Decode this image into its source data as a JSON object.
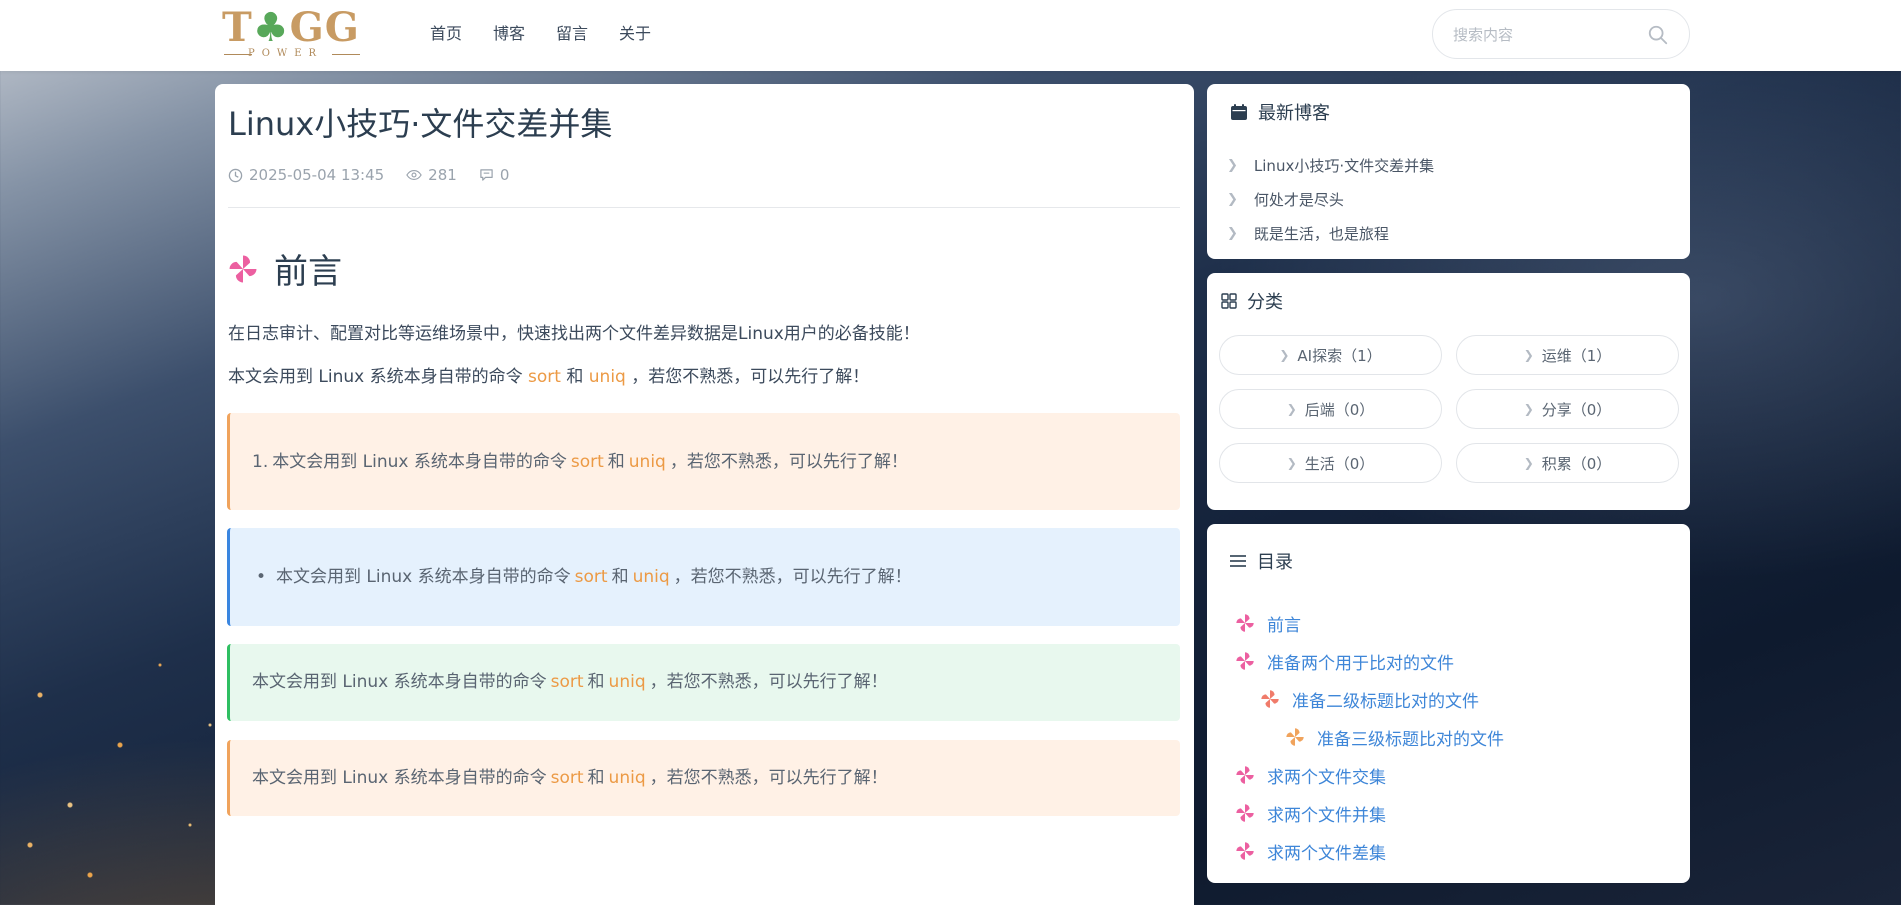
{
  "header": {
    "logo": {
      "main": "TOGG",
      "sub": "POWER"
    },
    "nav": [
      "首页",
      "博客",
      "留言",
      "关于"
    ],
    "search": {
      "placeholder": "搜索内容"
    }
  },
  "post": {
    "title": "Linux小技巧·文件交差并集",
    "meta": {
      "date": "2025-05-04 13:45",
      "views": "281",
      "comments": "0"
    },
    "heading": "前言",
    "para1": "在日志审计、配置对比等运维场景中，快速找出两个文件差异数据是Linux用户的必备技能！",
    "para2": {
      "before": "本文会用到 Linux 系统本身自带的命令",
      "cmd1": "sort",
      "and": "和",
      "cmd2": "uniq",
      "after": "，若您不熟悉，可以先行了解！"
    },
    "box1_prefix": "1.",
    "box2_prefix": "•"
  },
  "sidebar": {
    "recent": {
      "title": "最新博客",
      "items": [
        "Linux小技巧·文件交差并集",
        "何处才是尽头",
        "既是生活，也是旅程"
      ]
    },
    "categories": {
      "title": "分类",
      "items": [
        "AI探索（1）",
        "运维（1）",
        "后端（0）",
        "分享（0）",
        "生活（0）",
        "积累（0）"
      ]
    },
    "toc": {
      "title": "目录",
      "items": [
        "前言",
        "准备两个用于比对的文件",
        "准备二级标题比对的文件",
        "准备三级标题比对的文件",
        "求两个文件交集",
        "求两个文件并集",
        "求两个文件差集"
      ]
    }
  },
  "colors": {
    "accent": "#3e86d8",
    "highlight": "#ec9a45",
    "pinwheel_pink": "#ec5fa0",
    "pinwheel_red": "#f07b6a",
    "pinwheel_orange": "#f0a35c"
  }
}
